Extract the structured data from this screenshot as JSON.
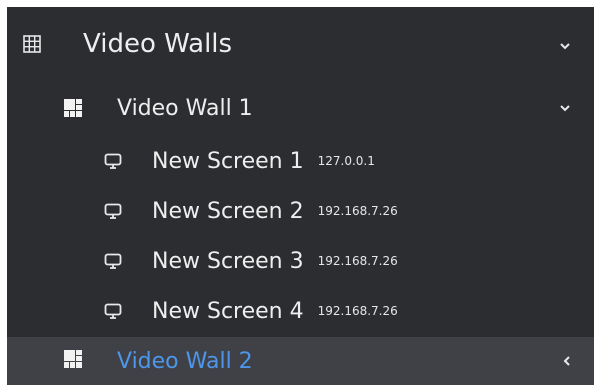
{
  "tree": {
    "root": {
      "label": "Video Walls",
      "icon": "video-walls-grid-icon",
      "expanded": true
    },
    "walls": [
      {
        "label": "Video Wall 1",
        "icon": "video-wall-icon",
        "expanded": true,
        "screens": [
          {
            "label": "New Screen 1",
            "ip": "127.0.0.1",
            "icon": "monitor-icon"
          },
          {
            "label": "New Screen 2",
            "ip": "192.168.7.26",
            "icon": "monitor-icon"
          },
          {
            "label": "New Screen 3",
            "ip": "192.168.7.26",
            "icon": "monitor-icon"
          },
          {
            "label": "New Screen 4",
            "ip": "192.168.7.26",
            "icon": "monitor-icon"
          }
        ]
      },
      {
        "label": "Video Wall 2",
        "icon": "video-wall-icon",
        "expanded": false,
        "selected": true
      }
    ]
  },
  "colors": {
    "panel_bg": "#2b2d31",
    "selected_bg": "#3f4147",
    "selected_text": "#4d96ea",
    "text": "#eeeeee"
  }
}
